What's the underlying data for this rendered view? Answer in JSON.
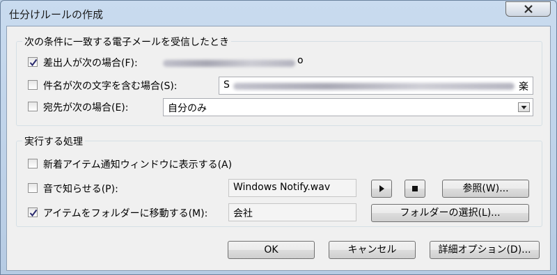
{
  "window": {
    "title": "仕分けルールの作成",
    "close_icon": "close-icon"
  },
  "conditions": {
    "legend": "次の条件に一致する電子メールを受信したとき",
    "from": {
      "label": "差出人が次の場合(F):",
      "checked": true,
      "value_suffix": "o"
    },
    "subject": {
      "label": "件名が次の文字を含む場合(S):",
      "checked": false,
      "value_prefix": "S",
      "value_suffix": "楽"
    },
    "to": {
      "label": "宛先が次の場合(E):",
      "checked": false,
      "selected": "自分のみ"
    }
  },
  "actions": {
    "legend": "実行する処理",
    "notify": {
      "label": "新着アイテム通知ウィンドウに表示する(A)",
      "checked": false
    },
    "sound": {
      "label": "音で知らせる(P):",
      "checked": false,
      "file": "Windows Notify.wav",
      "play_icon": "play-icon",
      "stop_icon": "stop-icon",
      "browse_label": "参照(W)..."
    },
    "move": {
      "label": "アイテムをフォルダーに移動する(M):",
      "checked": true,
      "folder": "会社",
      "select_folder_label": "フォルダーの選択(L)..."
    }
  },
  "footer": {
    "ok_label": "OK",
    "cancel_label": "キャンセル",
    "advanced_label": "詳細オプション(D)..."
  }
}
